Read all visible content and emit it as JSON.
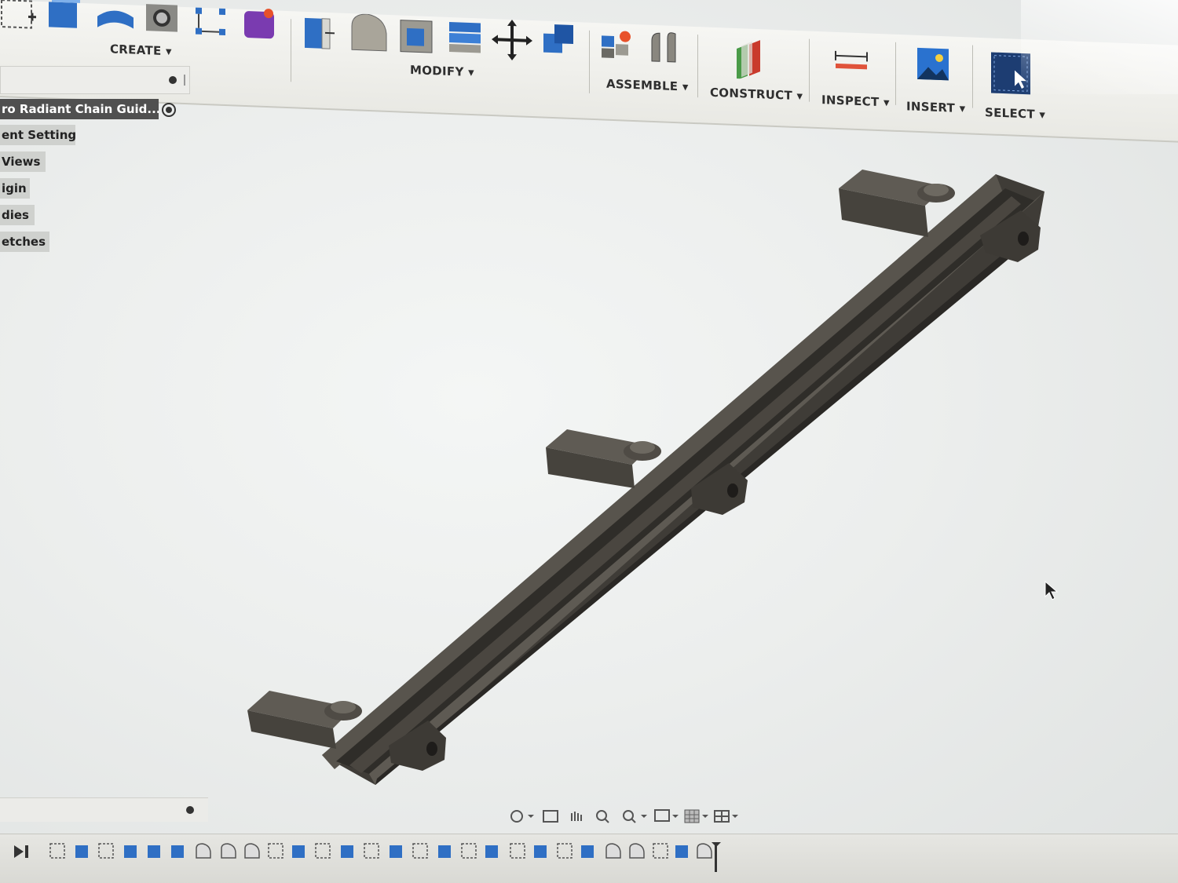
{
  "toolbar": {
    "groups": [
      {
        "label": "CREATE ▾",
        "icons": [
          "new-sketch-icon",
          "extrude-icon",
          "revolve-icon",
          "hole-icon",
          "rectangular-pattern-icon",
          "create-form-icon"
        ]
      },
      {
        "label": "MODIFY ▾",
        "icons": [
          "press-pull-icon",
          "fillet-icon",
          "shell-icon",
          "combine-icon",
          "move-icon",
          "align-icon"
        ]
      },
      {
        "label": "ASSEMBLE ▾",
        "icons": [
          "new-component-icon",
          "joint-icon"
        ]
      },
      {
        "label": "CONSTRUCT ▾",
        "icons": [
          "offset-plane-icon"
        ]
      },
      {
        "label": "INSPECT ▾",
        "icons": [
          "measure-icon"
        ]
      },
      {
        "label": "INSERT ▾",
        "icons": [
          "insert-image-icon"
        ]
      },
      {
        "label": "SELECT ▾",
        "icons": [
          "select-icon"
        ]
      }
    ]
  },
  "browser": {
    "root": "ro Radiant Chain Guid...",
    "items": [
      "ent Settings",
      "Views",
      "igin",
      "dies",
      "etches"
    ]
  },
  "colors": {
    "model": "#4c4842",
    "model_light": "#6a665f",
    "model_dark": "#36332f",
    "accent_blue": "#2f6fc4"
  }
}
